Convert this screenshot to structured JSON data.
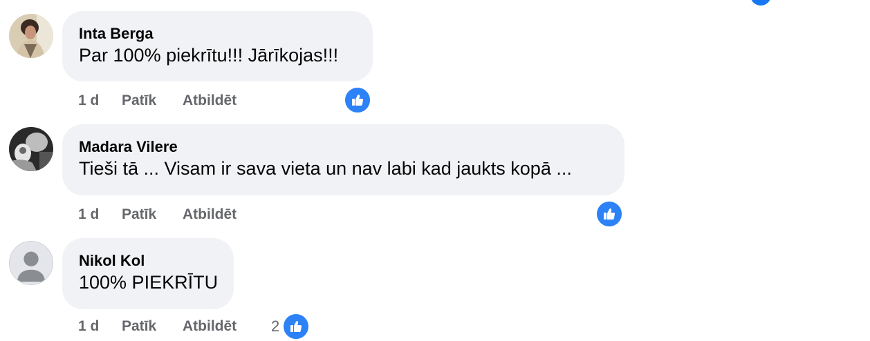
{
  "comments": [
    {
      "author": "Inta Berga",
      "text": "Par 100% piekrītu!!! Jārīkojas!!!",
      "time": "1 d",
      "like_label": "Patīk",
      "reply_label": "Atbildēt",
      "reaction_icon": "like-icon",
      "reaction_count": ""
    },
    {
      "author": "Madara Vilere",
      "text": "Tieši tā ... Visam ir sava vieta un nav labi kad jaukts kopā ...",
      "time": "1 d",
      "like_label": "Patīk",
      "reply_label": "Atbildēt",
      "reaction_icon": "like-icon",
      "reaction_count": ""
    },
    {
      "author": "Nikol Kol",
      "text": "100% PIEKRĪTU",
      "time": "1 d",
      "like_label": "Patīk",
      "reply_label": "Atbildēt",
      "reaction_icon": "like-icon",
      "reaction_count": "2"
    }
  ],
  "colors": {
    "bubble": "#f0f2f5",
    "action_text": "#65676b",
    "like_blue": "#2c82f6"
  }
}
